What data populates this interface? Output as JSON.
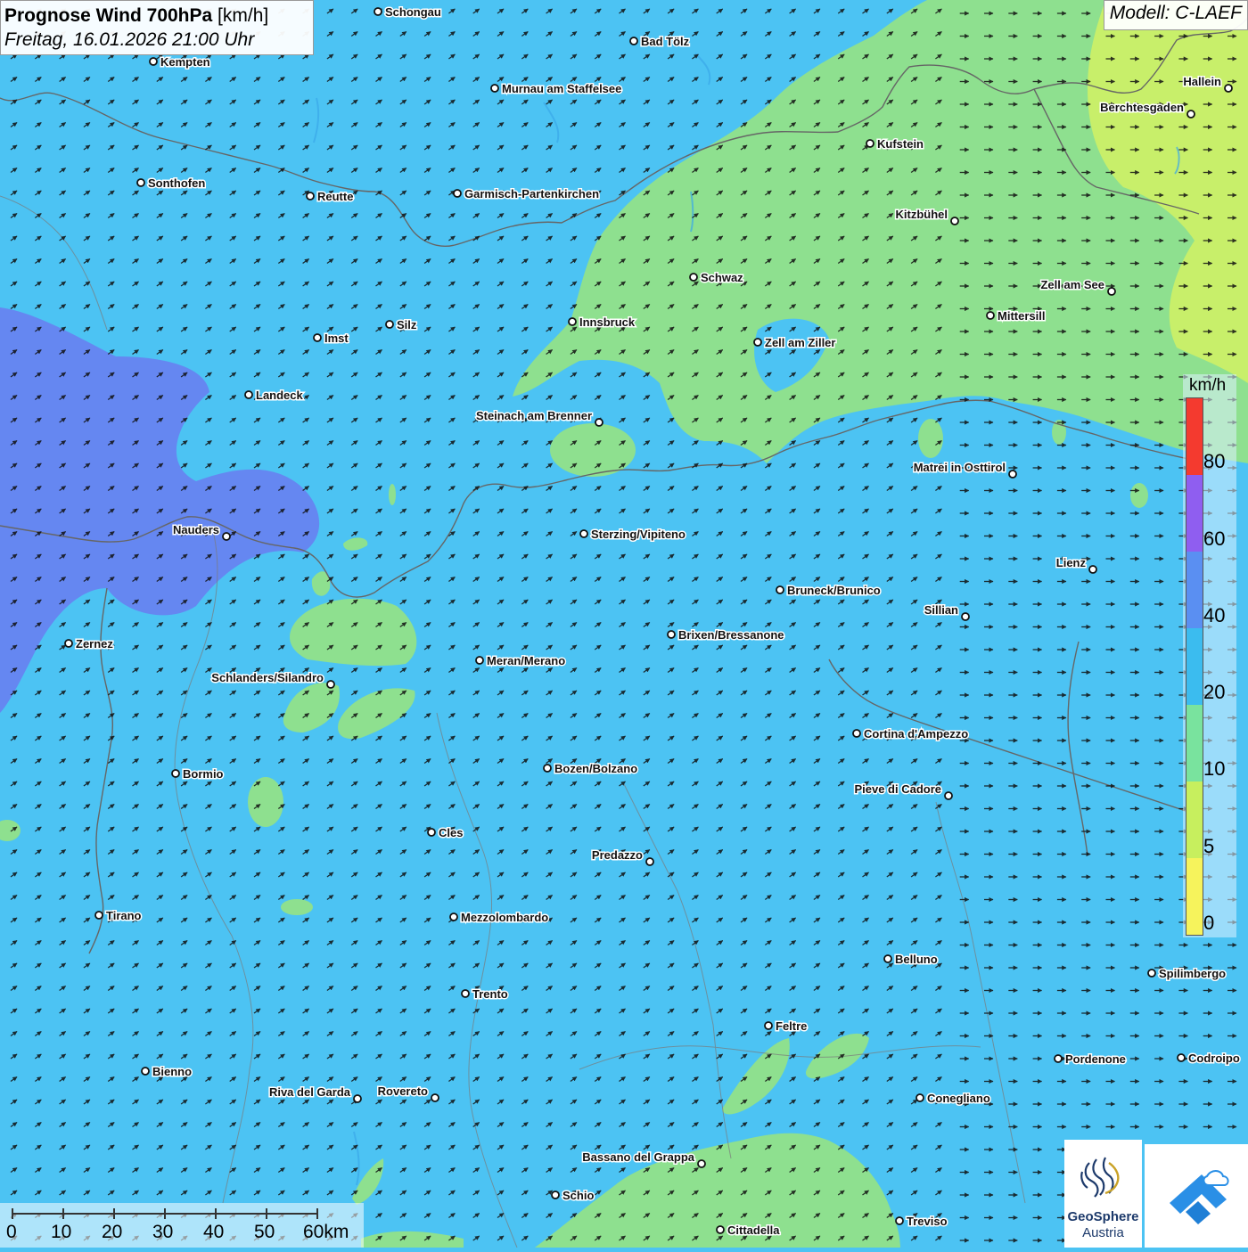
{
  "header": {
    "title_bold": "Prognose Wind 700hPa",
    "title_unit": "[km/h]",
    "datetime": "Freitag, 16.01.2026 21:00 Uhr",
    "model": "Modell: C-LAEF"
  },
  "legend": {
    "unit": "km/h",
    "ticks": [
      "80",
      "60",
      "40",
      "20",
      "10",
      "5",
      "0"
    ],
    "colors": [
      "#f43a2f",
      "#8f5ef0",
      "#5a8ff2",
      "#3bbcef",
      "#79e39e",
      "#c7ef5e",
      "#f6f35c"
    ]
  },
  "scale_bar": {
    "labels": [
      "0",
      "10",
      "20",
      "30",
      "40",
      "50",
      "60km"
    ]
  },
  "logos": {
    "geosphere_line1": "GeoSphere",
    "geosphere_line2": "Austria",
    "colors": {
      "geosphere": "#1d3a6b",
      "blue_logo": "#2a8fe6"
    }
  },
  "map_colors": {
    "wind_10_20": "#4cc3f3",
    "wind_5_10": "#8ee08f",
    "wind_0_5": "#c8ef6a",
    "wind_20_40": "#6a7cf0",
    "border": "#666666"
  },
  "cities": [
    {
      "name": "Schongau"
    },
    {
      "name": "Bad Tölz"
    },
    {
      "name": "Kempten"
    },
    {
      "name": "Murnau am Staffelsee"
    },
    {
      "name": "Hallein"
    },
    {
      "name": "Berchtesgaden"
    },
    {
      "name": "Kufstein"
    },
    {
      "name": "Sonthofen"
    },
    {
      "name": "Reutte"
    },
    {
      "name": "Garmisch-Partenkirchen"
    },
    {
      "name": "Kitzbühel"
    },
    {
      "name": "Schwaz"
    },
    {
      "name": "Zell am See"
    },
    {
      "name": "Mittersill"
    },
    {
      "name": "Innsbruck"
    },
    {
      "name": "Silz"
    },
    {
      "name": "Imst"
    },
    {
      "name": "Zell am Ziller"
    },
    {
      "name": "Landeck"
    },
    {
      "name": "Steinach am Brenner"
    },
    {
      "name": "Matrei in Osttirol"
    },
    {
      "name": "Nauders"
    },
    {
      "name": "Sterzing/Vipiteno"
    },
    {
      "name": "Lienz"
    },
    {
      "name": "Bruneck/Brunico"
    },
    {
      "name": "Sillian"
    },
    {
      "name": "Brixen/Bressanone"
    },
    {
      "name": "Zernez"
    },
    {
      "name": "Meran/Merano"
    },
    {
      "name": "Schlanders/Silandro"
    },
    {
      "name": "Cortina d'Ampezzo"
    },
    {
      "name": "Bozen/Bolzano"
    },
    {
      "name": "Bormio"
    },
    {
      "name": "Pieve di Cadore"
    },
    {
      "name": "Cles"
    },
    {
      "name": "Predazzo"
    },
    {
      "name": "Tirano"
    },
    {
      "name": "Mezzolombardo"
    },
    {
      "name": "Belluno"
    },
    {
      "name": "Spilimbergo"
    },
    {
      "name": "Trento"
    },
    {
      "name": "Feltre"
    },
    {
      "name": "Pordenone"
    },
    {
      "name": "Codroipo"
    },
    {
      "name": "Bienno"
    },
    {
      "name": "Riva del Garda"
    },
    {
      "name": "Rovereto"
    },
    {
      "name": "Conegliano"
    },
    {
      "name": "Bassano del Grappa"
    },
    {
      "name": "Schio"
    },
    {
      "name": "Treviso"
    },
    {
      "name": "Cittadella"
    }
  ]
}
